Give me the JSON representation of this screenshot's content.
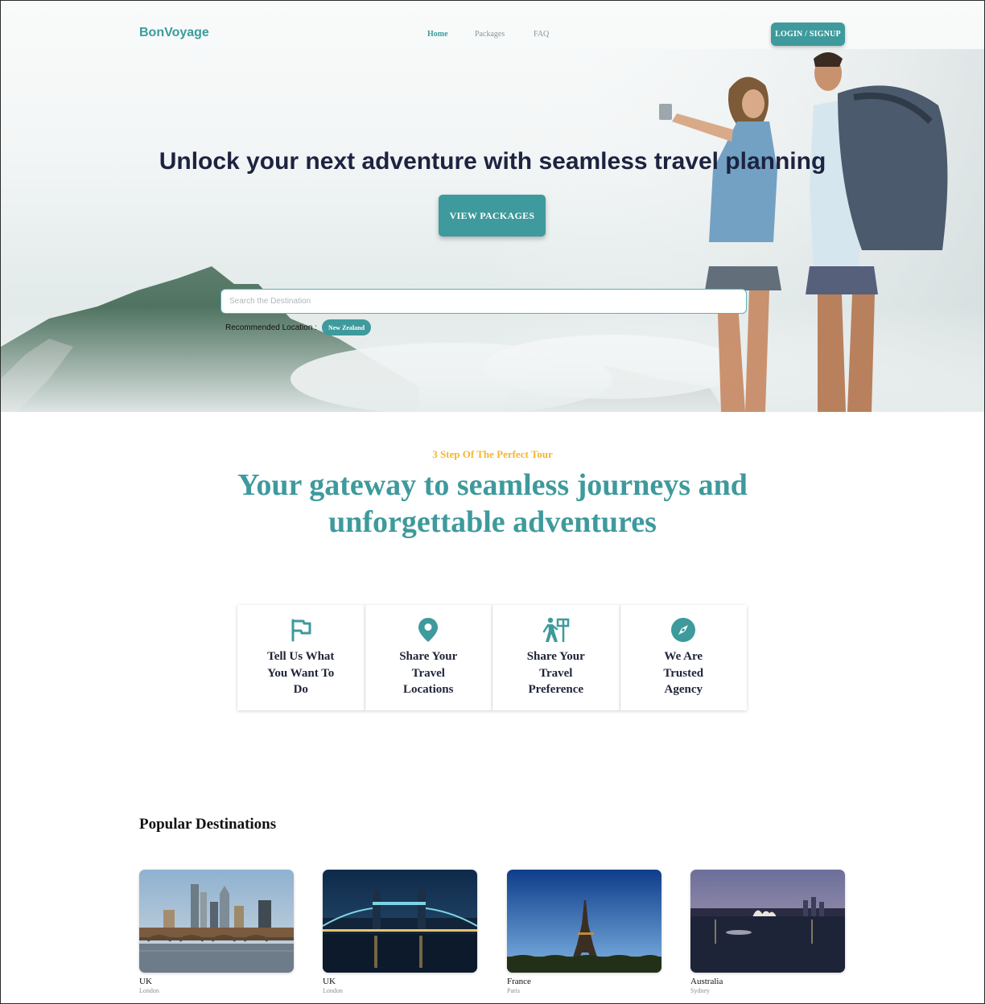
{
  "header": {
    "brand": "BonVoyage",
    "nav": [
      "Home",
      "Packages",
      "FAQ"
    ],
    "active_nav": "Home",
    "login_label": "LOGIN / SIGNUP"
  },
  "hero": {
    "title": "Unlock your next adventure with seamless travel planning",
    "cta_label": "VIEW PACKAGES",
    "search_placeholder": "Search the Destination",
    "recommended_label": "Recommended Location :",
    "recommended_chip": "New Zealand"
  },
  "steps_section": {
    "eyebrow": "3 Step Of The Perfect Tour",
    "headline": "Your gateway to seamless journeys and unforgettable adventures",
    "steps": [
      {
        "icon": "flag-icon",
        "label": "Tell Us What You Want To Do"
      },
      {
        "icon": "location-pin-icon",
        "label": "Share Your Travel Locations"
      },
      {
        "icon": "hiker-signpost-icon",
        "label": "Share Your Travel Preference"
      },
      {
        "icon": "compass-icon",
        "label": "We Are Trusted Agency"
      }
    ]
  },
  "destinations": {
    "title": "Popular Destinations",
    "items": [
      {
        "country": "UK",
        "city": "London",
        "image": "london-skyline-bridge"
      },
      {
        "country": "UK",
        "city": "London",
        "image": "tower-bridge-night"
      },
      {
        "country": "France",
        "city": "Paris",
        "image": "eiffel-tower"
      },
      {
        "country": "Australia",
        "city": "Sydney",
        "image": "sydney-opera-house-harbour"
      }
    ]
  },
  "colors": {
    "accent": "#3e9a9c",
    "eyebrow": "#f2b632",
    "heading_dark": "#1d2340"
  }
}
